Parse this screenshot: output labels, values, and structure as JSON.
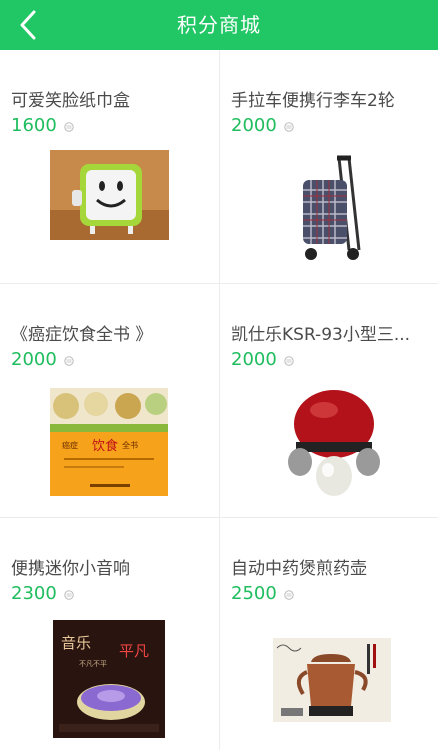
{
  "header": {
    "title": "积分商城"
  },
  "products": [
    {
      "name": "可爱笑脸纸巾盒",
      "points": "1600"
    },
    {
      "name": "手拉车便携行李车2轮",
      "points": "2000"
    },
    {
      "name": "《癌症饮食全书 》",
      "points": "2000"
    },
    {
      "name": "凯仕乐KSR-93小型三...",
      "points": "2000"
    },
    {
      "name": "便携迷你小音响",
      "points": "2300"
    },
    {
      "name": "自动中药煲煎药壶",
      "points": "2500"
    }
  ],
  "images": {
    "book_cover": {
      "title_a": "癌症",
      "title_b": "饮食",
      "title_c": "全书"
    },
    "speaker_ad": {
      "line_a": "音乐",
      "line_b": "平凡",
      "line_c": "不凡不平"
    }
  },
  "colors": {
    "accent": "#20c764",
    "price": "#1fbd5e",
    "divider": "#ececec"
  }
}
